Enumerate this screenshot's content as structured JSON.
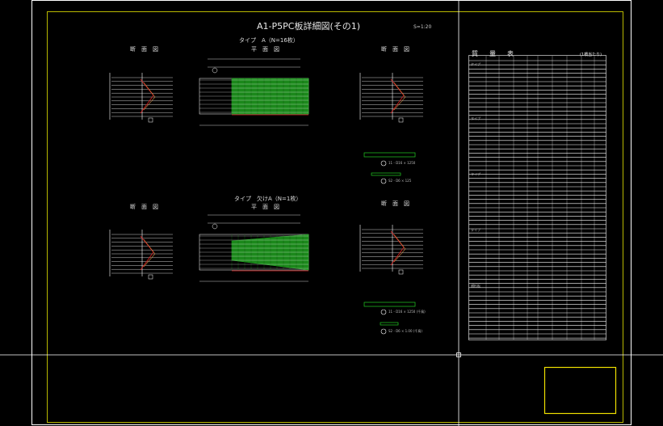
{
  "drawing": {
    "title": "A1-P5PC板詳細図(その1)",
    "scale": "S=1:20",
    "type_a_heading": "タイプ　A（N=16枚）",
    "type_b_heading": "タイプ　欠けA（N=1枚）",
    "plan_label": "平　面　図",
    "section_label": "断　面　図",
    "table_title": "質　量　表",
    "table_unit": "(1橋当たり)",
    "table_sections": [
      "タイプ",
      "タイプ",
      "タイプ",
      "タイプ",
      "横桁板"
    ],
    "note_a1": "11 - D16 × 1250",
    "note_a2": "S2 - D6 × 125",
    "note_b1": "11 - D16 × 1250 (千鳥)",
    "note_b2": "S2 - D6 × 1.00 (千鳥)"
  },
  "colors": {
    "background": "#000000",
    "frame": "#ffffff",
    "inner_frame": "#e6e600",
    "crosshair": "#ffffff",
    "hatch_green": "#22aa22",
    "red": "#e02020",
    "title_block": "#f0e000"
  }
}
